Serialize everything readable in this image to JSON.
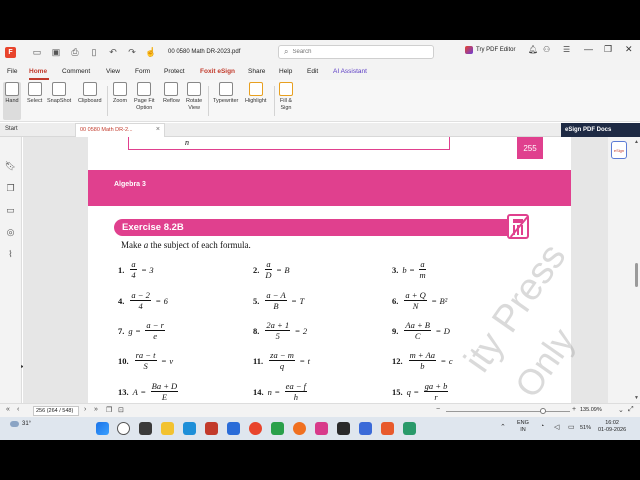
{
  "window": {
    "doc_title": "00 0580 Math DR-2023.pdf",
    "search_placeholder": "Search",
    "try_editor": "Try PDF Editor"
  },
  "menu": [
    "File",
    "Home",
    "Comment",
    "View",
    "Form",
    "Protect",
    "Foxit eSign",
    "Share",
    "Help",
    "Edit",
    "AI Assistant"
  ],
  "ribbon": [
    {
      "label": "Hand",
      "icon": "hand-icon"
    },
    {
      "label": "Select",
      "icon": "select-icon"
    },
    {
      "label": "SnapShot",
      "icon": "snapshot-icon"
    },
    {
      "label": "Clipboard",
      "icon": "clipboard-icon"
    },
    {
      "label": "Zoom",
      "icon": "zoom-icon"
    },
    {
      "label": "Page Fit\nOption",
      "icon": "page-fit-icon"
    },
    {
      "label": "Reflow",
      "icon": "reflow-icon"
    },
    {
      "label": "Rotate\nView",
      "icon": "rotate-icon"
    },
    {
      "label": "Typewriter",
      "icon": "typewriter-icon"
    },
    {
      "label": "Highlight",
      "icon": "highlight-icon"
    },
    {
      "label": "Fill &\nSign",
      "icon": "fill-sign-icon"
    }
  ],
  "tabs": {
    "start": "Start",
    "doc": "00 0580 Math DR-2...",
    "esign_banner": "eSign PDF Docs"
  },
  "document": {
    "prev_box_text": "n",
    "page_number": "255",
    "chapter": "Algebra 3",
    "exercise": "Exercise 8.2B",
    "instruction_pre": "Make ",
    "instruction_var": "a",
    "instruction_post": " the subject of each formula.",
    "watermark1": "ity Press",
    "watermark2": "Only",
    "problems": [
      {
        "num": "1.",
        "type": "frac_eq",
        "n": "a",
        "d": "4",
        "rhs": "3"
      },
      {
        "num": "2.",
        "type": "frac_eq",
        "n": "a",
        "d": "D",
        "rhs": "B"
      },
      {
        "num": "3.",
        "type": "lhs_frac",
        "lhs": "b",
        "n": "a",
        "d": "m"
      },
      {
        "num": "4.",
        "type": "frac_eq",
        "n": "a − 2",
        "d": "4",
        "rhs": "6"
      },
      {
        "num": "5.",
        "type": "frac_eq",
        "n": "a − A",
        "d": "B",
        "rhs": "T"
      },
      {
        "num": "6.",
        "type": "frac_eq",
        "n": "a + Q",
        "d": "N",
        "rhs": "B²"
      },
      {
        "num": "7.",
        "type": "lhs_frac",
        "lhs": "g",
        "n": "a − r",
        "d": "e"
      },
      {
        "num": "8.",
        "type": "frac_eq",
        "n": "2a + 1",
        "d": "5",
        "rhs": "2"
      },
      {
        "num": "9.",
        "type": "frac_eq",
        "n": "Aa + B",
        "d": "C",
        "rhs": "D"
      },
      {
        "num": "10.",
        "type": "frac_eq",
        "n": "ra − t",
        "d": "S",
        "rhs": "v"
      },
      {
        "num": "11.",
        "type": "frac_eq",
        "n": "za − m",
        "d": "q",
        "rhs": "t"
      },
      {
        "num": "12.",
        "type": "frac_eq",
        "n": "m + Aa",
        "d": "b",
        "rhs": "c"
      },
      {
        "num": "13.",
        "type": "lhs_frac",
        "lhs": "A",
        "n": "Ba + D",
        "d": "E"
      },
      {
        "num": "14.",
        "type": "lhs_frac",
        "lhs": "n",
        "n": "ea − f",
        "d": "h"
      },
      {
        "num": "15.",
        "type": "lhs_frac",
        "lhs": "q",
        "n": "ga + b",
        "d": "r"
      }
    ]
  },
  "status": {
    "page_field": "256 (264 / 548)",
    "zoom": "135.09%"
  },
  "taskbar": {
    "weather": "31°",
    "lang1": "ENG",
    "lang2": "IN",
    "battery": "51%",
    "time": "16:02",
    "date": "01-09-2026"
  },
  "colors": {
    "accent": "#c23a2b",
    "magenta": "#e0408e"
  }
}
